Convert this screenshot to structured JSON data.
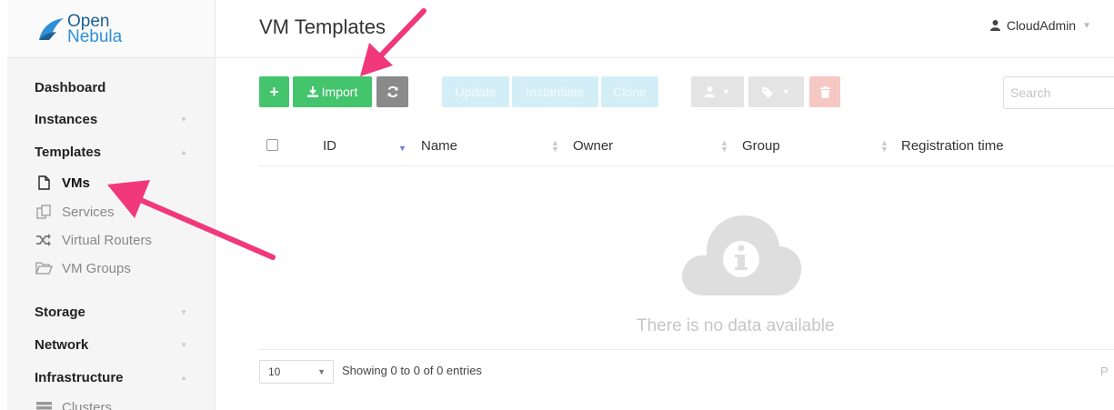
{
  "brand": {
    "line1": "Open",
    "line2": "Nebula"
  },
  "header": {
    "title": "VM Templates",
    "user": "CloudAdmin"
  },
  "sidebar": {
    "items": [
      {
        "label": "Dashboard"
      },
      {
        "label": "Instances"
      },
      {
        "label": "Templates"
      },
      {
        "label": "Storage"
      },
      {
        "label": "Network"
      },
      {
        "label": "Infrastructure"
      }
    ],
    "template_sub": [
      {
        "label": "VMs",
        "icon": "file-icon"
      },
      {
        "label": "Services",
        "icon": "services-icon"
      },
      {
        "label": "Virtual Routers",
        "icon": "shuffle-icon"
      },
      {
        "label": "VM Groups",
        "icon": "folder-open-icon"
      }
    ],
    "infra_sub": [
      {
        "label": "Clusters",
        "icon": "server-icon"
      }
    ]
  },
  "toolbar": {
    "add_label": "+",
    "import_label": "Import",
    "update_label": "Update",
    "instantiate_label": "Instantiate",
    "clone_label": "Clone"
  },
  "search": {
    "placeholder": "Search"
  },
  "table": {
    "columns": [
      "ID",
      "Name",
      "Owner",
      "Group",
      "Registration time"
    ],
    "empty_text": "There is no data available"
  },
  "footer": {
    "page_size": "10",
    "showing": "Showing 0 to 0 of 0 entries",
    "pager_partial": "P"
  },
  "colors": {
    "accent_green": "#43c46d",
    "annotation_arrow": "#f0387a"
  }
}
